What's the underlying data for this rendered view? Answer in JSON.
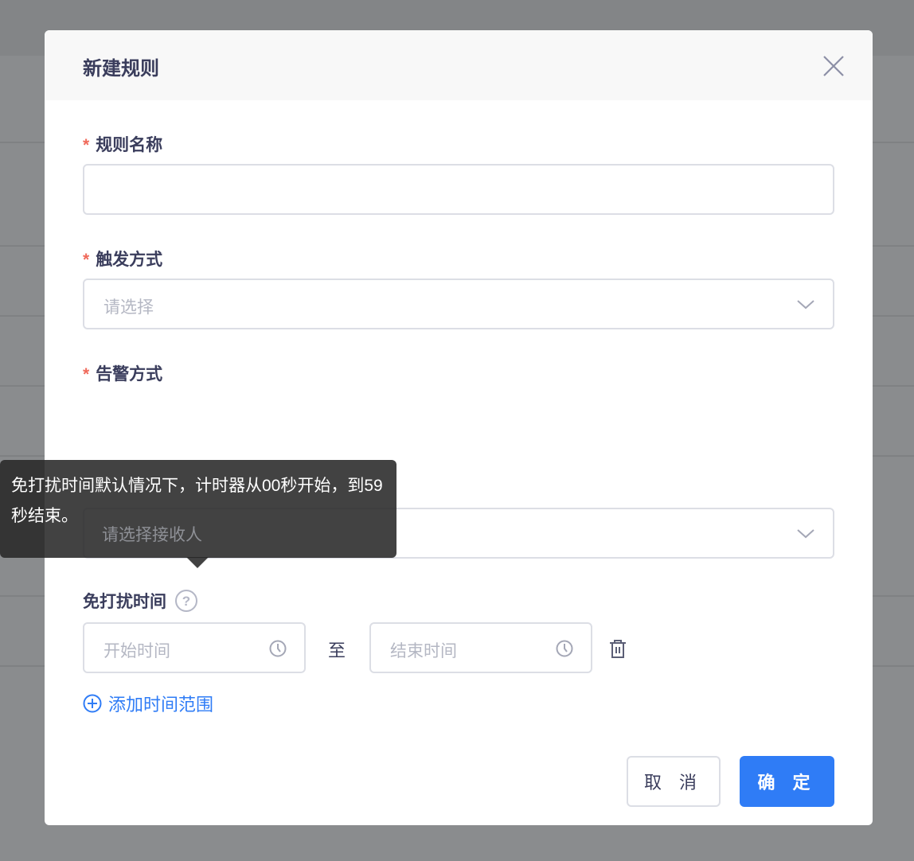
{
  "modal": {
    "title": "新建规则",
    "close_icon": "close-icon"
  },
  "form": {
    "rule_name": {
      "label": "规则名称",
      "required_mark": "*",
      "value": ""
    },
    "trigger": {
      "label": "触发方式",
      "required_mark": "*",
      "placeholder": "请选择"
    },
    "alert": {
      "label": "告警方式",
      "required_mark": "*"
    },
    "receiver": {
      "placeholder": "请选择接收人"
    },
    "dnd": {
      "label": "免打扰时间",
      "start_placeholder": "开始时间",
      "separator": "至",
      "end_placeholder": "结束时间",
      "add_label": "添加时间范围"
    }
  },
  "tooltip": {
    "text": "免打扰时间默认情况下，计时器从00秒开始，到59秒结束。"
  },
  "footer": {
    "cancel": "取 消",
    "ok": "确 定"
  },
  "colors": {
    "primary": "#2f7cf6",
    "required": "#f06a5b",
    "title": "#3a3d5c"
  }
}
